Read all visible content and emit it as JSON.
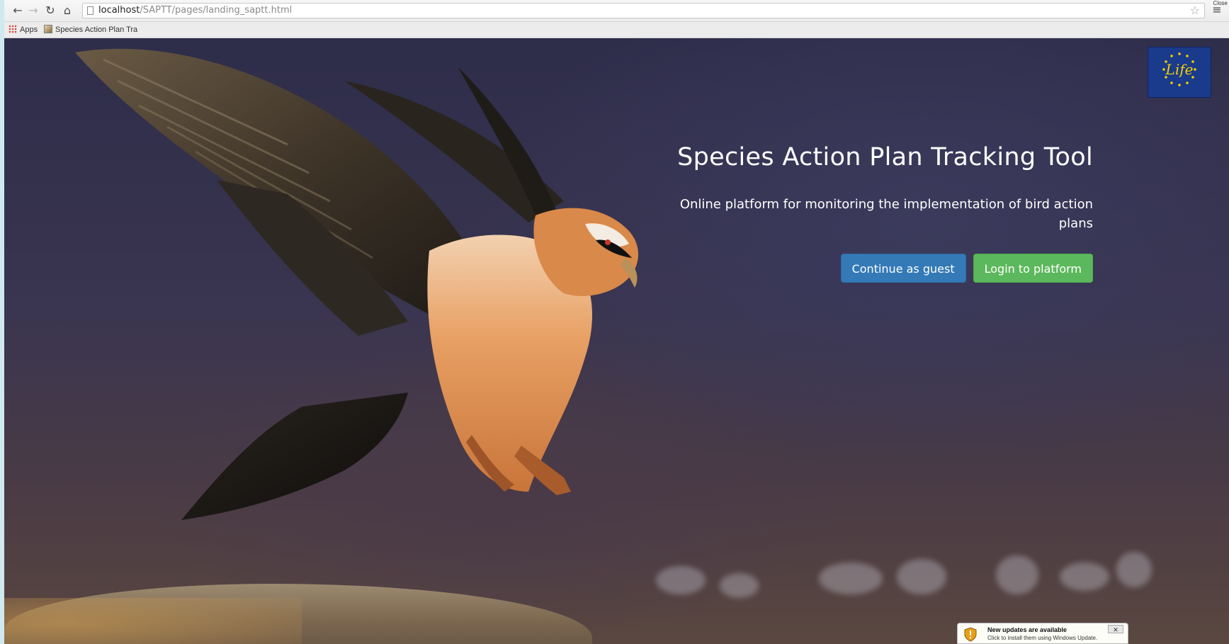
{
  "browser": {
    "url_host": "localhost",
    "url_path": "/SAPTT/pages/landing_saptt.html",
    "bookmarks": [
      {
        "label": "Apps",
        "icon": "apps-grid-icon"
      },
      {
        "label": "Species Action Plan Tra",
        "icon": "favicon-icon"
      }
    ],
    "window_close_label": "Close"
  },
  "hero": {
    "title": "Species Action Plan Tracking Tool",
    "subtitle": "Online platform for monitoring the implementation of bird action plans",
    "guest_button": "Continue as guest",
    "login_button": "Login to platform"
  },
  "logo": {
    "text": "Life",
    "icon": "eu-life-logo"
  },
  "notification": {
    "title": "New updates are available",
    "text": "Click to install them using Windows Update.",
    "icon": "shield-icon",
    "close_label": "✕"
  },
  "colors": {
    "guest_button": "#337ab7",
    "login_button": "#5cb85c",
    "logo_background": "#1a3a8c"
  }
}
